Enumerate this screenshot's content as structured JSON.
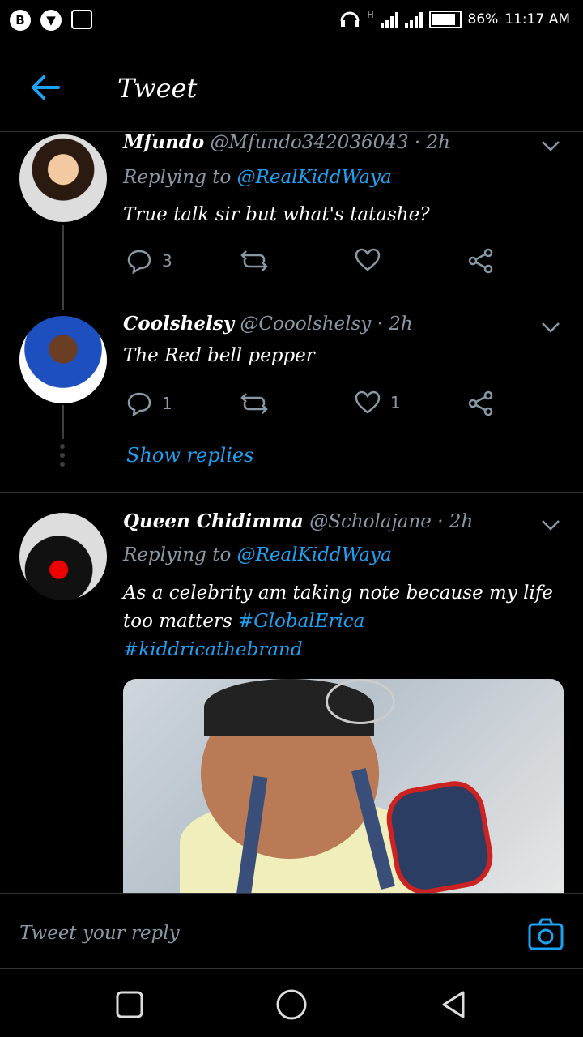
{
  "status_bar": {
    "left_icons": [
      "b-app-icon",
      "shield-icon",
      "image-icon"
    ],
    "network": "H",
    "battery": "86%",
    "time": "11:17 AM"
  },
  "header": {
    "title": "Tweet"
  },
  "tweets": [
    {
      "name": "Mfundo",
      "handle": "@Mfundo342036043",
      "time": "· 2h",
      "replying_prefix": "Replying to",
      "replying_to": "@RealKiddWaya",
      "text": "True talk sir but what's tatashe?",
      "replies": "3",
      "retweets": "",
      "likes": ""
    },
    {
      "name": "Coolshelsy",
      "handle": "@Cooolshelsy",
      "time": "· 2h",
      "text": "The Red bell pepper",
      "replies": "1",
      "retweets": "",
      "likes": "1"
    },
    {
      "name": "Queen Chidimma",
      "handle": "@Scholajane",
      "time": "· 2h",
      "replying_prefix": "Replying to",
      "replying_to": "@RealKiddWaya",
      "text": "As a celebrity am taking note because my life too matters",
      "hashtag1": "#GlobalErica",
      "hashtag2": "#kiddricathebrand"
    }
  ],
  "show_replies": "Show replies",
  "reply_bar": {
    "placeholder": "Tweet your reply"
  },
  "colors": {
    "accent": "#1da1f2",
    "muted": "#8899a6",
    "background": "#000000",
    "divider": "#2f3336"
  }
}
